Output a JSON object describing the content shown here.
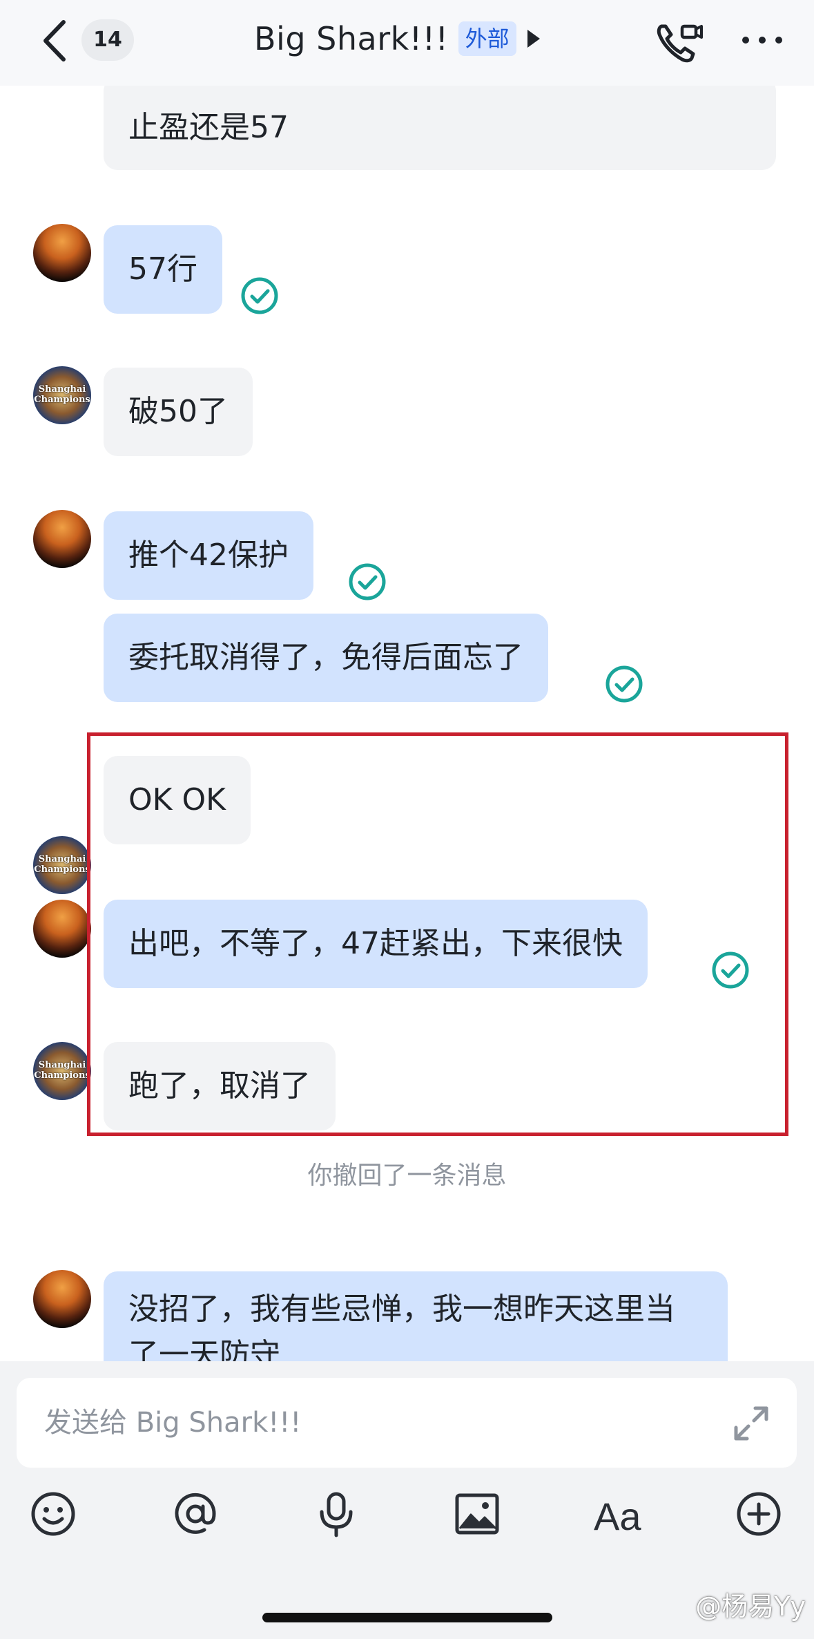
{
  "header": {
    "unread_count": "14",
    "title": "Big Shark!!!",
    "external_badge": "外部"
  },
  "messages": [
    {
      "text": "止盈还是57",
      "side": "theirs"
    },
    {
      "text": "57行",
      "side": "mine",
      "read": true
    },
    {
      "text": "破50了",
      "side": "theirs"
    },
    {
      "text": "推个42保护",
      "side": "mine",
      "read": true
    },
    {
      "text": "委托取消得了，免得后面忘了",
      "side": "mine",
      "read": true
    },
    {
      "text": "OK OK",
      "side": "theirs"
    },
    {
      "text": "出吧，不等了，47赶紧出，下来很快",
      "side": "mine",
      "read": true
    },
    {
      "text": "跑了，取消了",
      "side": "theirs"
    },
    {
      "text": "没招了，我有些忌惮，我一想昨天这里当了一天防守",
      "side": "mine"
    }
  ],
  "recall_notice": "你撤回了一条消息",
  "avatar_logo_text": "Shanghai Champions",
  "composer": {
    "placeholder": "发送给 Big Shark!!!"
  },
  "toolbar": {
    "icons": [
      "emoji-icon",
      "mention-icon",
      "microphone-icon",
      "image-icon",
      "text-format-icon",
      "plus-icon"
    ],
    "text_format_label": "Aa"
  },
  "watermark": "@杨易Yy",
  "colors": {
    "my_bubble": "#d2e3fe",
    "their_bubble": "#f2f3f5",
    "read_check": "#1aa59a",
    "highlight_border": "#c8202e",
    "external_badge_bg": "#d9e6ff"
  }
}
